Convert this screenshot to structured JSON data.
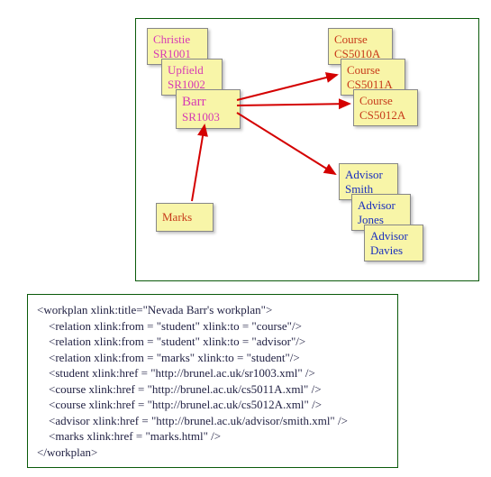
{
  "diagram": {
    "students": [
      {
        "name": "Christie",
        "id": "SR1001"
      },
      {
        "name": "Upfield",
        "id": "SR1002"
      },
      {
        "name": "Barr",
        "id": "SR1003"
      }
    ],
    "courses": [
      {
        "label": "Course",
        "id": "CS5010A"
      },
      {
        "label": "Course",
        "id": "CS5011A"
      },
      {
        "label": "Course",
        "id": "CS5012A"
      }
    ],
    "advisors": [
      {
        "label": "Advisor",
        "name": "Smith"
      },
      {
        "label": "Advisor",
        "name": "Jones"
      },
      {
        "label": "Advisor",
        "name": "Davies"
      }
    ],
    "marks_label": "Marks",
    "arrows": [
      {
        "from": "student:SR1003",
        "to": "course:CS5011A"
      },
      {
        "from": "student:SR1003",
        "to": "course:CS5012A"
      },
      {
        "from": "student:SR1003",
        "to": "advisor:Smith"
      },
      {
        "from": "marks",
        "to": "student:SR1003"
      }
    ]
  },
  "code": {
    "lines": [
      "<workplan xlink:title=\"Nevada Barr's workplan\">",
      "    <relation xlink:from = \"student\" xlink:to = \"course\"/>",
      "    <relation xlink:from = \"student\" xlink:to = \"advisor\"/>",
      "    <relation xlink:from = \"marks\" xlink:to = \"student\"/>",
      "    <student xlink:href = \"http://brunel.ac.uk/sr1003.xml\" />",
      "    <course xlink:href = \"http://brunel.ac.uk/cs5011A.xml\" />",
      "    <course xlink:href = \"http://brunel.ac.uk/cs5012A.xml\" />",
      "    <advisor xlink:href = \"http://brunel.ac.uk/advisor/smith.xml\" />",
      "    <marks xlink:href = \"marks.html\" />",
      "</workplan>"
    ]
  }
}
